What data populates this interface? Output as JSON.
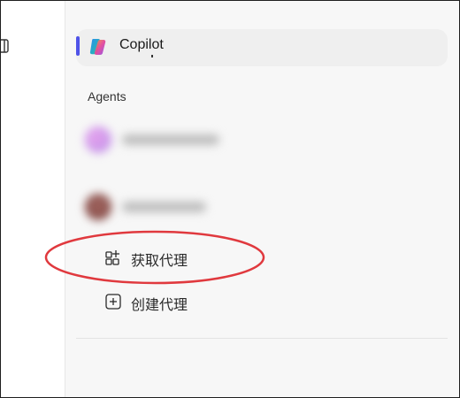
{
  "sidebar": {
    "copilot": {
      "label": "Copilot",
      "icon": "copilot-logo-icon",
      "accent": "#4f53e8"
    },
    "agents_heading": "Agents",
    "actions": [
      {
        "label": "获取代理",
        "icon": "app-grid-add-icon"
      },
      {
        "label": "创建代理",
        "icon": "plus-square-icon"
      }
    ]
  },
  "highlight": {
    "color": "#e0393e"
  }
}
